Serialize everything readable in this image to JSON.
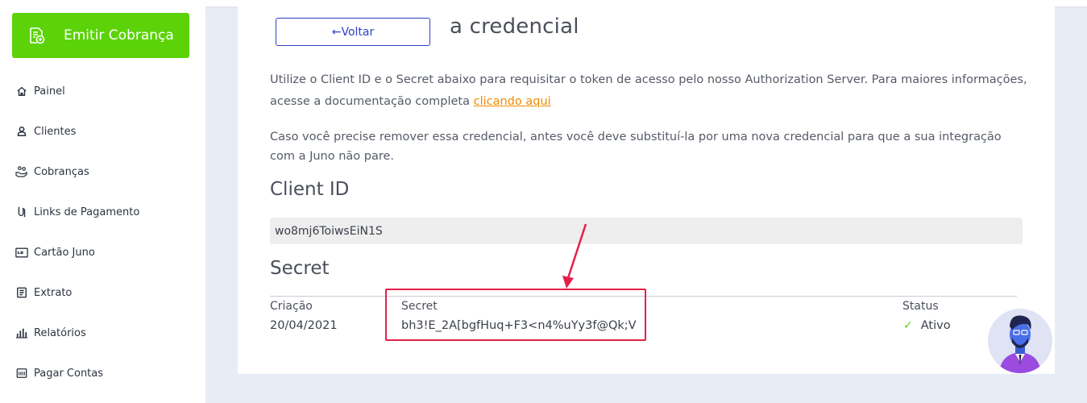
{
  "sidebar": {
    "emit_button": "Emitir Cobrança",
    "items": [
      {
        "label": "Painel",
        "icon": "home-icon"
      },
      {
        "label": "Clientes",
        "icon": "user-icon"
      },
      {
        "label": "Cobranças",
        "icon": "hand-coins-icon"
      },
      {
        "label": "Links de Pagamento",
        "icon": "link-icon"
      },
      {
        "label": "Cartão Juno",
        "icon": "card-icon"
      },
      {
        "label": "Extrato",
        "icon": "statement-icon"
      },
      {
        "label": "Relatórios",
        "icon": "bar-chart-icon"
      },
      {
        "label": "Pagar Contas",
        "icon": "barcode-icon"
      }
    ]
  },
  "main": {
    "title": "a credencial",
    "back_label": "←Voltar",
    "paragraph1_text": "Utilize o Client ID e o Secret abaixo para requisitar o token de acesso pelo nosso Authorization Server. Para maiores informações, acesse a documentação completa ",
    "paragraph1_link": "clicando aqui",
    "paragraph2": "Caso você precise remover essa credencial, antes você deve substituí-la por uma nova credencial para que a sua integração com a Juno não pare.",
    "client_id_heading": "Client ID",
    "client_id_value": "wo8mj6ToiwsEiN1S",
    "secret_heading": "Secret",
    "table": {
      "creation_header": "Criação",
      "creation_value": "20/04/2021",
      "secret_header": "Secret",
      "secret_value": "bh3!E_2A[bgfHuq+F3<n4%uYy3f@Qk;V",
      "status_header": "Status",
      "status_value": "Ativo"
    }
  },
  "colors": {
    "accent_green": "#5bd308",
    "link_orange": "#f08c00",
    "primary_blue": "#2d42c4",
    "highlight_red": "#e4204a"
  }
}
